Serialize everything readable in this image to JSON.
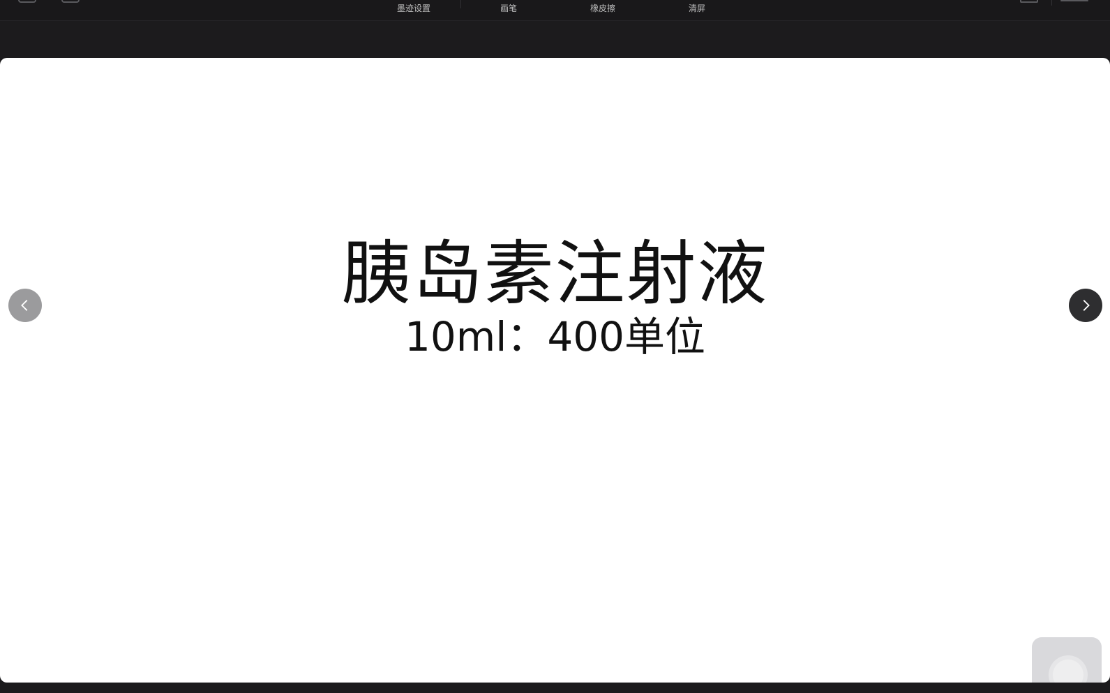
{
  "toolbar": {
    "ink_settings": "墨迹设置",
    "pen": "画笔",
    "eraser": "橡皮擦",
    "clear_screen": "清屏"
  },
  "slide": {
    "title": "胰岛素注射液",
    "subtitle": "10ml：400单位"
  },
  "navigation": {
    "prev_icon": "chevron-left-icon",
    "next_icon": "chevron-right-icon"
  },
  "colors": {
    "toolbar_bg": "#19181a",
    "slide_bg": "#ffffff",
    "text": "#111111",
    "prev_btn": "#9b9b9d",
    "next_btn": "#2e2e30"
  }
}
